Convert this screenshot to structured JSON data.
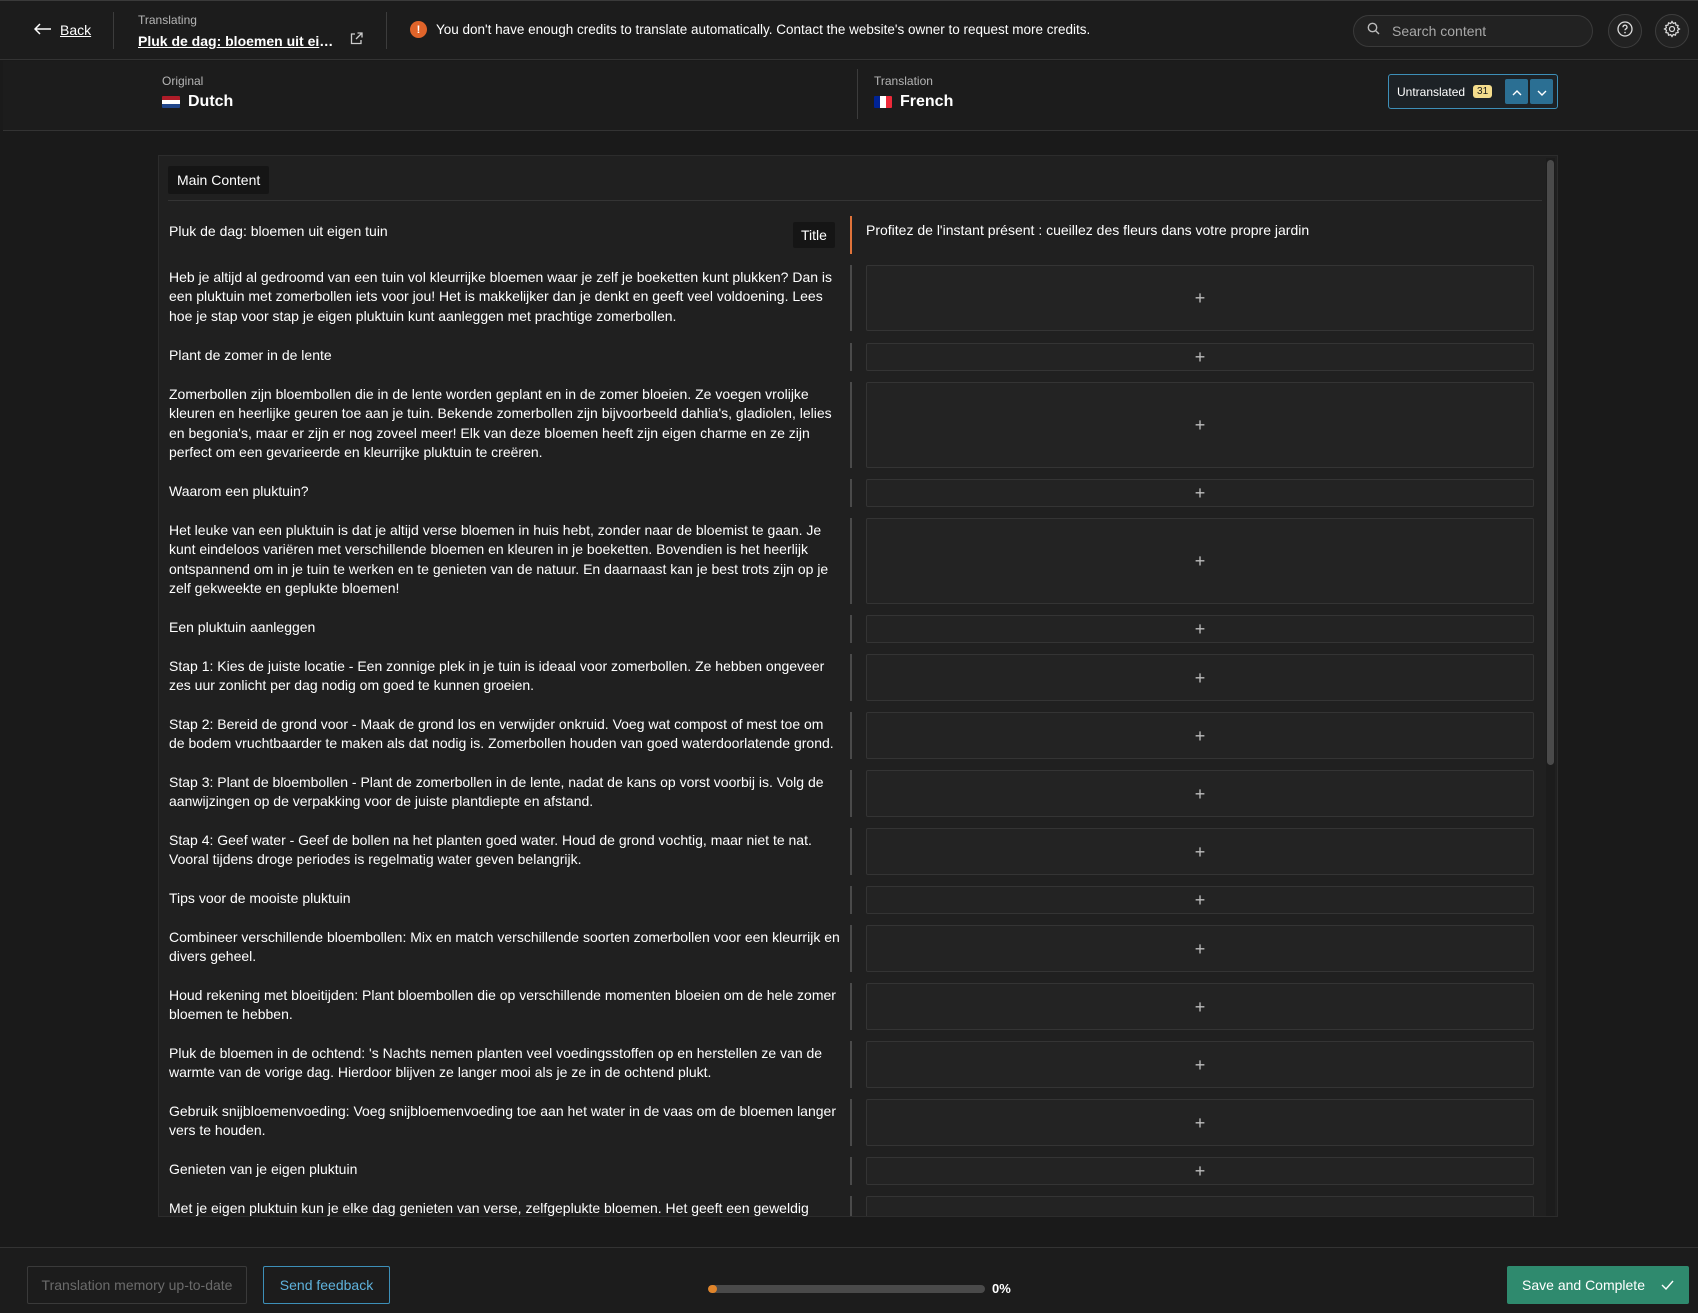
{
  "topbar": {
    "back_label": "Back",
    "translating_label": "Translating",
    "document_title": "Pluk de dag: bloemen uit eige...",
    "credits_warning": "You don't have enough credits to translate automatically. Contact the website's owner to request more credits.",
    "search_placeholder": "Search content"
  },
  "languages": {
    "original_label": "Original",
    "original_name": "Dutch",
    "translation_label": "Translation",
    "translation_name": "French"
  },
  "filter": {
    "label": "Untranslated",
    "count": "31"
  },
  "section": {
    "label": "Main Content"
  },
  "title_row": {
    "source": "Pluk de dag: bloemen uit eigen tuin",
    "tag": "Title",
    "translation": "Profitez de l'instant présent : cueillez des fleurs dans votre propre jardin"
  },
  "rows": [
    {
      "source": "Heb je altijd al gedroomd van een tuin vol kleurrijke bloemen waar je zelf je boeketten kunt plukken? Dan is een pluktuin met zomerbollen iets voor jou! Het is makkelijker dan je denkt en geeft veel voldoening. Lees hoe je stap voor stap je eigen pluktuin kunt aanleggen met prachtige zomerbollen."
    },
    {
      "source": "Plant de zomer in de lente"
    },
    {
      "source": "Zomerbollen zijn bloembollen die in de lente worden geplant en in de zomer bloeien. Ze voegen vrolijke kleuren en heerlijke geuren toe aan je tuin. Bekende zomerbollen zijn bijvoorbeeld dahlia's, gladiolen, lelies en begonia's, maar er zijn er nog zoveel meer! Elk van deze bloemen heeft zijn eigen charme en ze zijn perfect om een gevarieerde en kleurrijke pluktuin te creëren."
    },
    {
      "source": "Waarom een pluktuin?"
    },
    {
      "source": "Het leuke van een pluktuin is dat je altijd verse bloemen in huis hebt, zonder naar de bloemist te gaan. Je kunt eindeloos variëren met verschillende bloemen en kleuren in je boeketten. Bovendien is het heerlijk ontspannend om in je tuin te werken en te genieten van de natuur. En daarnaast kan je best trots zijn op je zelf gekweekte en geplukte bloemen!"
    },
    {
      "source": "Een pluktuin aanleggen"
    },
    {
      "source": "Stap 1: Kies de juiste locatie - Een zonnige plek in je tuin is ideaal voor zomerbollen. Ze hebben ongeveer zes uur zonlicht per dag nodig om goed te kunnen groeien."
    },
    {
      "source": "Stap 2: Bereid de grond voor - Maak de grond los en verwijder onkruid. Voeg wat compost of mest toe om de bodem vruchtbaarder te maken als dat nodig is. Zomerbollen houden van goed waterdoorlatende grond."
    },
    {
      "source": "Stap 3: Plant de bloembollen - Plant de zomerbollen in de lente, nadat de kans op vorst voorbij is. Volg de aanwijzingen op de verpakking voor de juiste plantdiepte en afstand."
    },
    {
      "source": "Stap 4: Geef water - Geef de bollen na het planten goed water. Houd de grond vochtig, maar niet te nat. Vooral tijdens droge periodes is regelmatig water geven belangrijk."
    },
    {
      "source": "Tips voor de mooiste pluktuin"
    },
    {
      "source": "Combineer verschillende bloembollen: Mix en match verschillende soorten zomerbollen voor een kleurrijk en divers geheel."
    },
    {
      "source": "Houd rekening met bloeitijden: Plant bloembollen die op verschillende momenten bloeien om de hele zomer bloemen te hebben."
    },
    {
      "source": "Pluk de bloemen in de ochtend: 's Nachts nemen planten veel voedingsstoffen op en herstellen ze van de warmte van de vorige dag. Hierdoor blijven ze langer mooi als je ze in de ochtend plukt."
    },
    {
      "source": "Gebruik snijbloemenvoeding: Voeg snijbloemenvoeding toe aan het water in de vaas om de bloemen langer vers te houden."
    },
    {
      "source": "Genieten van je eigen pluktuin"
    },
    {
      "source": "Met je eigen pluktuin kun je elke dag genieten van verse, zelfgeplukte bloemen. Het geeft een geweldig"
    }
  ],
  "footer": {
    "tm_label": "Translation memory up-to-date",
    "feedback_label": "Send feedback",
    "progress_percent": 0,
    "progress_text": "0%",
    "save_label": "Save and Complete"
  },
  "colors": {
    "accent_blue": "#3d8fb8",
    "save_green": "#2f8a6e",
    "warning_orange": "#e0642a",
    "active_row": "#e0733a"
  },
  "icons": {
    "back": "arrow-left-icon",
    "external": "external-link-icon",
    "warning": "exclamation-icon",
    "search": "search-icon",
    "help": "question-circle-icon",
    "settings": "gear-icon",
    "up": "chevron-up-icon",
    "down": "chevron-down-icon",
    "add": "plus-icon",
    "check": "check-icon"
  }
}
